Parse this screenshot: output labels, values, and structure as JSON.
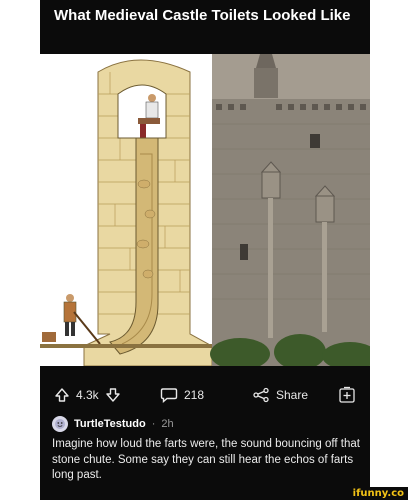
{
  "post": {
    "title": "What Medieval Castle Toilets Looked Like"
  },
  "actions": {
    "upvotes": "4.3k",
    "comments": "218",
    "share_label": "Share",
    "icons": [
      "upvote-icon",
      "downvote-icon",
      "comment-icon",
      "share-icon",
      "add-icon"
    ]
  },
  "comment": {
    "username": "TurtleTestudo",
    "separator": "·",
    "time": "2h",
    "text": "Imagine how loud the farts were, the sound bouncing off that stone chute. Some say they can still hear the echos of farts long past."
  },
  "watermark": "ifunny.co",
  "colors": {
    "background": "#0b0b0b",
    "text": "#ffffff",
    "brand": "#f3c316"
  }
}
